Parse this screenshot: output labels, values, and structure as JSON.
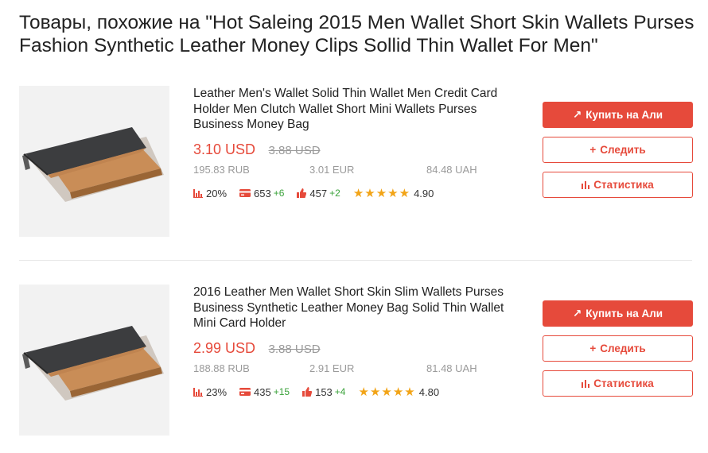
{
  "page": {
    "title": "Товары, похожие на \"Hot Saleing 2015 Men Wallet Short Skin Wallets Purses Fashion Synthetic Leather Money Clips Sollid Thin Wallet For Men\""
  },
  "colors": {
    "accent": "#e64a3b",
    "muted": "#9a9a9a",
    "positive": "#3aa23a",
    "star": "#f2a417"
  },
  "buttons": {
    "buy": "Купить на Али",
    "follow": "Следить",
    "stats": "Статистика",
    "buy_icon": "arrow-up-right-icon",
    "follow_icon": "plus-icon",
    "stats_icon": "bar-chart-icon"
  },
  "products": [
    {
      "title": "Leather Men's Wallet Solid Thin Wallet Men Credit Card Holder Men Clutch Wallet Short Mini Wallets Purses Business Money Bag",
      "price": "3.10 USD",
      "old_price": "3.88 USD",
      "rub": "195.83 RUB",
      "eur": "3.01 EUR",
      "uah": "84.48 UAH",
      "discount": "20%",
      "orders": "653",
      "orders_delta": "+6",
      "likes": "457",
      "likes_delta": "+2",
      "stars": 5,
      "rating": "4.90"
    },
    {
      "title": "2016 Leather Men Wallet Short Skin Slim Wallets Purses Business Synthetic Leather Money Bag Solid Thin Wallet Mini Card Holder",
      "price": "2.99 USD",
      "old_price": "3.88 USD",
      "rub": "188.88 RUB",
      "eur": "2.91 EUR",
      "uah": "81.48 UAH",
      "discount": "23%",
      "orders": "435",
      "orders_delta": "+15",
      "likes": "153",
      "likes_delta": "+4",
      "stars": 5,
      "rating": "4.80"
    }
  ]
}
